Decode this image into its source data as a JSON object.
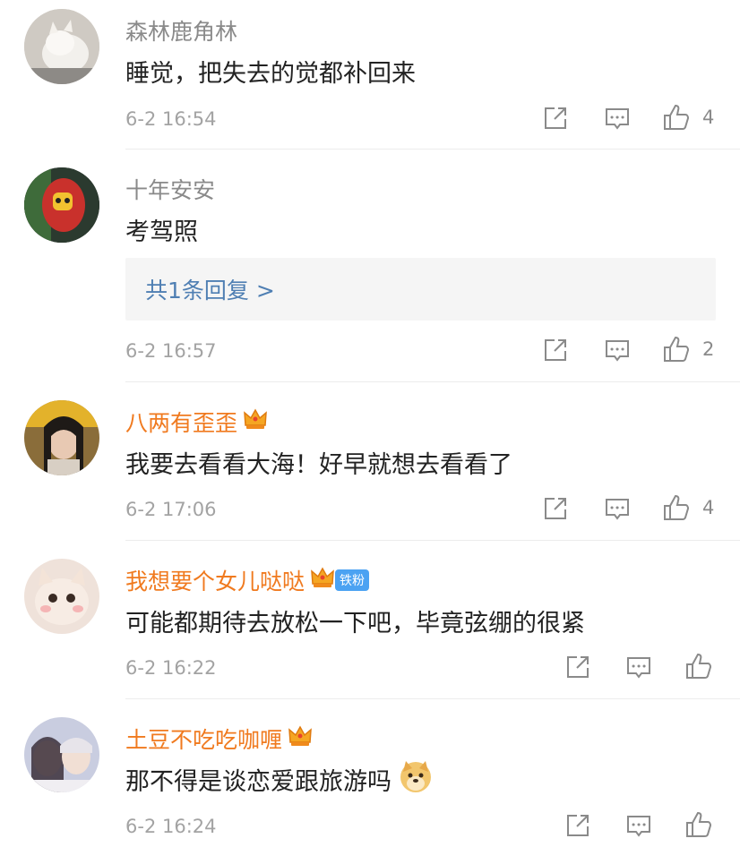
{
  "comments": [
    {
      "user": "森林鹿角林",
      "text": "睡觉，把失去的觉都补回来",
      "time": "6-2 16:54",
      "likes": "4",
      "vip": false
    },
    {
      "user": "十年安安",
      "text": "考驾照",
      "time": "6-2 16:57",
      "likes": "2",
      "vip": false,
      "replies": "共1条回复 >"
    },
    {
      "user": "八两有歪歪",
      "text": "我要去看看大海！好早就想去看看了",
      "time": "6-2 17:06",
      "likes": "4",
      "vip": true
    },
    {
      "user": "我想要个女儿哒哒",
      "text": "可能都期待去放松一下吧，毕竟弦绷的很紧",
      "time": "6-2 16:22",
      "likes": "",
      "vip": true,
      "badge": "铁粉"
    },
    {
      "user": "土豆不吃吃咖喱",
      "text": "那不得是谈恋爱跟旅游吗",
      "time": "6-2 16:24",
      "likes": "",
      "vip": true,
      "emoji": "doge-emoji"
    }
  ],
  "icons": {
    "share": "share-icon",
    "reply": "comment-icon",
    "like": "thumbs-up-icon",
    "crown": "crown-icon"
  },
  "colors": {
    "vip_name": "#f07a1f",
    "reply_link": "#4f7fb3",
    "badge": "#4ba2f2"
  }
}
